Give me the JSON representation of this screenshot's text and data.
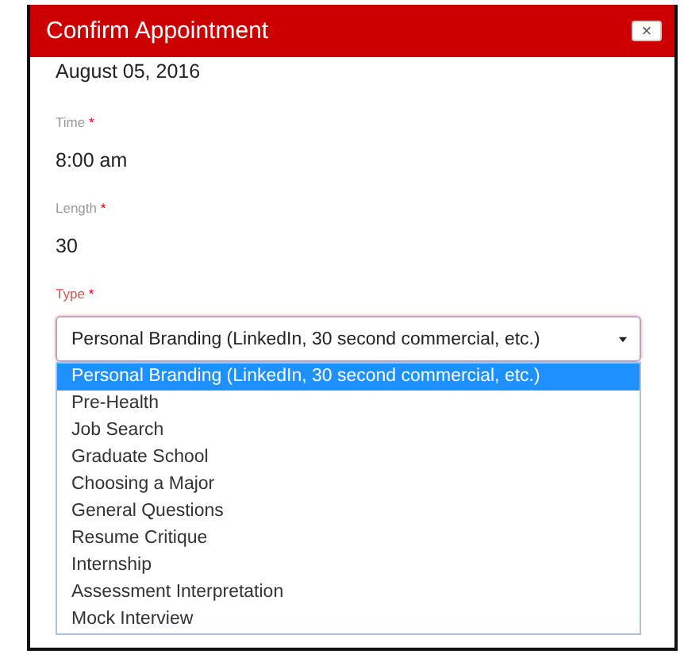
{
  "window": {
    "title": "Confirm Appointment",
    "close": "×"
  },
  "date": "August 05, 2016",
  "fields": [
    {
      "label": "Time",
      "required_mark": "*",
      "active": false,
      "value": "8:00 am"
    },
    {
      "label": "Length",
      "required_mark": "*",
      "active": false,
      "value": "30"
    }
  ],
  "type_field": {
    "label": "Type",
    "required_mark": "*",
    "active": true,
    "value": "Personal Branding (LinkedIn, 30 second commercial, etc.)",
    "expanded": true,
    "options": [
      {
        "label": "Personal Branding (LinkedIn, 30 second commercial, etc.)",
        "selected": true
      },
      {
        "label": "Pre-Health",
        "selected": false
      },
      {
        "label": "Job Search",
        "selected": false
      },
      {
        "label": "Graduate School",
        "selected": false
      },
      {
        "label": "Choosing a Major",
        "selected": false
      },
      {
        "label": "General Questions",
        "selected": false
      },
      {
        "label": "Resume Critique",
        "selected": false
      },
      {
        "label": "Internship",
        "selected": false
      },
      {
        "label": "Assessment Interpretation",
        "selected": false
      },
      {
        "label": "Mock Interview",
        "selected": false
      }
    ]
  }
}
